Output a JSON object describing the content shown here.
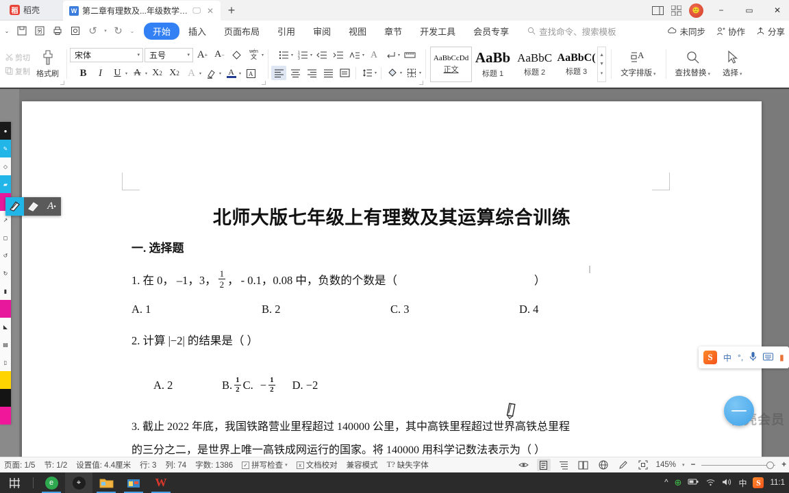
{
  "window": {
    "app_name": "稻壳",
    "document_tab": "第二章有理数及...年级数学上册",
    "tab_restore_icon": "restore-icon",
    "tab_close_icon": "close-icon",
    "new_tab_icon": "plus-icon",
    "split_view_icon": "split-view-icon",
    "grid_apps_icon": "grid-apps-icon",
    "avatar_icon": "user-avatar",
    "minimize": "−",
    "maximize": "▭",
    "close": "✕"
  },
  "quick_access": [
    {
      "name": "save-button",
      "glyph": "🖫"
    },
    {
      "name": "save-as-button",
      "glyph": "🖬"
    },
    {
      "name": "print-button",
      "glyph": "🖶"
    },
    {
      "name": "print-preview-button",
      "glyph": "🔍"
    },
    {
      "name": "undo-button",
      "glyph": "↺"
    },
    {
      "name": "redo-button",
      "glyph": "↻"
    },
    {
      "name": "customize-qat-button",
      "glyph": "⌄"
    }
  ],
  "menu": {
    "items": [
      {
        "label": "开始",
        "active": true
      },
      {
        "label": "插入",
        "active": false
      },
      {
        "label": "页面布局",
        "active": false
      },
      {
        "label": "引用",
        "active": false
      },
      {
        "label": "审阅",
        "active": false
      },
      {
        "label": "视图",
        "active": false
      },
      {
        "label": "章节",
        "active": false
      },
      {
        "label": "开发工具",
        "active": false
      },
      {
        "label": "会员专享",
        "active": false
      }
    ],
    "search_placeholder": "查找命令、搜索模板",
    "right_items": [
      {
        "label": "未同步",
        "icon": "cloud-sync-icon"
      },
      {
        "label": "协作",
        "icon": "collaborate-icon"
      },
      {
        "label": "分享",
        "icon": "share-icon"
      }
    ]
  },
  "ribbon": {
    "clipboard": {
      "cut_label": "剪切",
      "copy_label": "复制",
      "format_painter_label": "格式刷"
    },
    "font": {
      "family_value": "宋体",
      "size_value": "五号",
      "grow_font": "A⁺",
      "shrink_font": "A⁻",
      "clear_format": "clear-format-icon",
      "pinyin_guide": "wén",
      "bold": "B",
      "italic": "I",
      "underline": "U",
      "strikethrough": "A",
      "superscript": "X²",
      "subscript": "X₂",
      "text_effects": "A",
      "highlight": "highlight-icon",
      "font_color": "A",
      "char_border": "A"
    },
    "paragraph": {
      "bullets": "bullet-list-icon",
      "numbering": "numbered-list-icon",
      "decrease_indent": "decrease-indent-icon",
      "increase_indent": "increase-indent-icon",
      "sort": "sort-icon",
      "show_marks": "show-marks-icon",
      "line_break": "line-break-icon",
      "ruler": "ruler-icon",
      "align_left": "align-left-icon",
      "align_center": "align-center-icon",
      "align_right": "align-right-icon",
      "align_justify": "align-justify-icon",
      "distribute": "distribute-icon",
      "line_spacing": "line-spacing-icon",
      "shading": "shading-icon",
      "borders": "borders-icon"
    },
    "styles": [
      {
        "preview": "AaBbCcDd",
        "name": "正文",
        "size": "11px",
        "weight": "normal"
      },
      {
        "preview": "AaBb",
        "name": "标题 1",
        "size": "21px",
        "weight": "bold"
      },
      {
        "preview": "AaBbC",
        "name": "标题 2",
        "size": "17px",
        "weight": "normal"
      },
      {
        "preview": "AaBbC(",
        "name": "标题 3",
        "size": "16px",
        "weight": "bold"
      }
    ],
    "tools": [
      {
        "label": "文字排版",
        "icon": "text-layout-icon"
      },
      {
        "label": "查找替换",
        "icon": "find-replace-icon"
      },
      {
        "label": "选择",
        "icon": "select-icon"
      }
    ]
  },
  "document": {
    "title": "北师大版七年级上有理数及其运算综合训练",
    "section_heading": "一. 选择题",
    "questions": [
      {
        "stem_parts": [
          "1. 在 0，",
          "–1，3，",
          "，",
          "- 0.1，0.08 中，负数的个数是（",
          "）"
        ],
        "fraction": {
          "num": "1",
          "den": "2"
        },
        "options": [
          "A. 1",
          "B. 2",
          "C. 3",
          "D. 4"
        ]
      },
      {
        "stem": "2. 计算 |−2| 的结果是（     ）",
        "options_text": [
          "A.  2",
          "B.",
          "C.",
          "D.  −2"
        ],
        "frac_b": {
          "num": "1",
          "den": "2"
        },
        "frac_c_sign": "−",
        "frac_c": {
          "num": "1",
          "den": "2"
        }
      },
      {
        "stem": "3. 截止 2022 年底，我国铁路营业里程超过 140000 公里，其中高铁里程超过世界高铁总里程",
        "next_line": "的三分之二，是世界上唯一高铁成网运行的国家。将 140000 用科学记数法表示为（     ）"
      }
    ]
  },
  "ime": {
    "logo": "S",
    "mode": "中",
    "punct": "°,",
    "voice_icon": "microphone-icon",
    "keyboard_icon": "keyboard-icon",
    "more_icon": "more-icon"
  },
  "annotation_toolbar": {
    "pen_icon": "pen-icon",
    "eraser_icon": "eraser-icon",
    "text_icon": "text-tool-icon"
  },
  "watermark": "稻壳会员",
  "statusbar": {
    "left_items": [
      {
        "label": "页面: 1/5"
      },
      {
        "label": "节: 1/2"
      },
      {
        "label": "设置值: 4.4厘米"
      },
      {
        "label": "行: 3"
      },
      {
        "label": "列: 74"
      },
      {
        "label": "字数: 1386"
      },
      {
        "label": "拼写检查",
        "icon": "checkbox-checked-icon",
        "caret": true
      },
      {
        "label": "文档校对",
        "icon": "proofread-icon"
      },
      {
        "label": "兼容模式"
      },
      {
        "label": "缺失字体",
        "icon": "missing-font-icon"
      }
    ],
    "view_buttons": [
      {
        "name": "focus-mode",
        "icon": "eye-icon",
        "selected": false
      },
      {
        "name": "page-view",
        "icon": "page-view-icon",
        "selected": true
      },
      {
        "name": "outline-view",
        "icon": "outline-view-icon",
        "selected": false
      },
      {
        "name": "reading-view",
        "icon": "book-icon",
        "selected": false
      },
      {
        "name": "web-view",
        "icon": "globe-icon",
        "selected": false
      },
      {
        "name": "ink-view",
        "icon": "pencil-icon",
        "selected": false
      }
    ],
    "fit_icon": "fit-page-icon",
    "zoom_value": "145%",
    "zoom_minus": "−",
    "zoom_plus": "+"
  },
  "taskbar": {
    "start_icon": "start-icon",
    "task_view_icon": "task-view-icon",
    "apps": [
      {
        "name": "edge-browser",
        "glyph": "e",
        "color": "#2ea84f",
        "active": false
      },
      {
        "name": "location-app",
        "glyph": "⌖",
        "color": "#1f1f1f",
        "active": true
      },
      {
        "name": "file-explorer",
        "glyph": "📁",
        "color": "#f2b544",
        "active": false
      },
      {
        "name": "store-app",
        "glyph": "🏪",
        "color": "#3a87c8",
        "active": false
      },
      {
        "name": "wps-writer",
        "glyph": "W",
        "color": "#d9372b",
        "active": false
      }
    ],
    "tray": [
      {
        "name": "show-hidden-icons",
        "glyph": "^"
      },
      {
        "name": "security-shield-icon",
        "glyph": "✚"
      },
      {
        "name": "battery-icon",
        "glyph": "▰"
      },
      {
        "name": "wifi-icon",
        "glyph": "◟"
      },
      {
        "name": "volume-icon",
        "glyph": "🔊"
      },
      {
        "name": "ime-mode-icon",
        "glyph": "中"
      },
      {
        "name": "sogou-ime-icon",
        "glyph": "S"
      }
    ],
    "clock": "11:1"
  }
}
